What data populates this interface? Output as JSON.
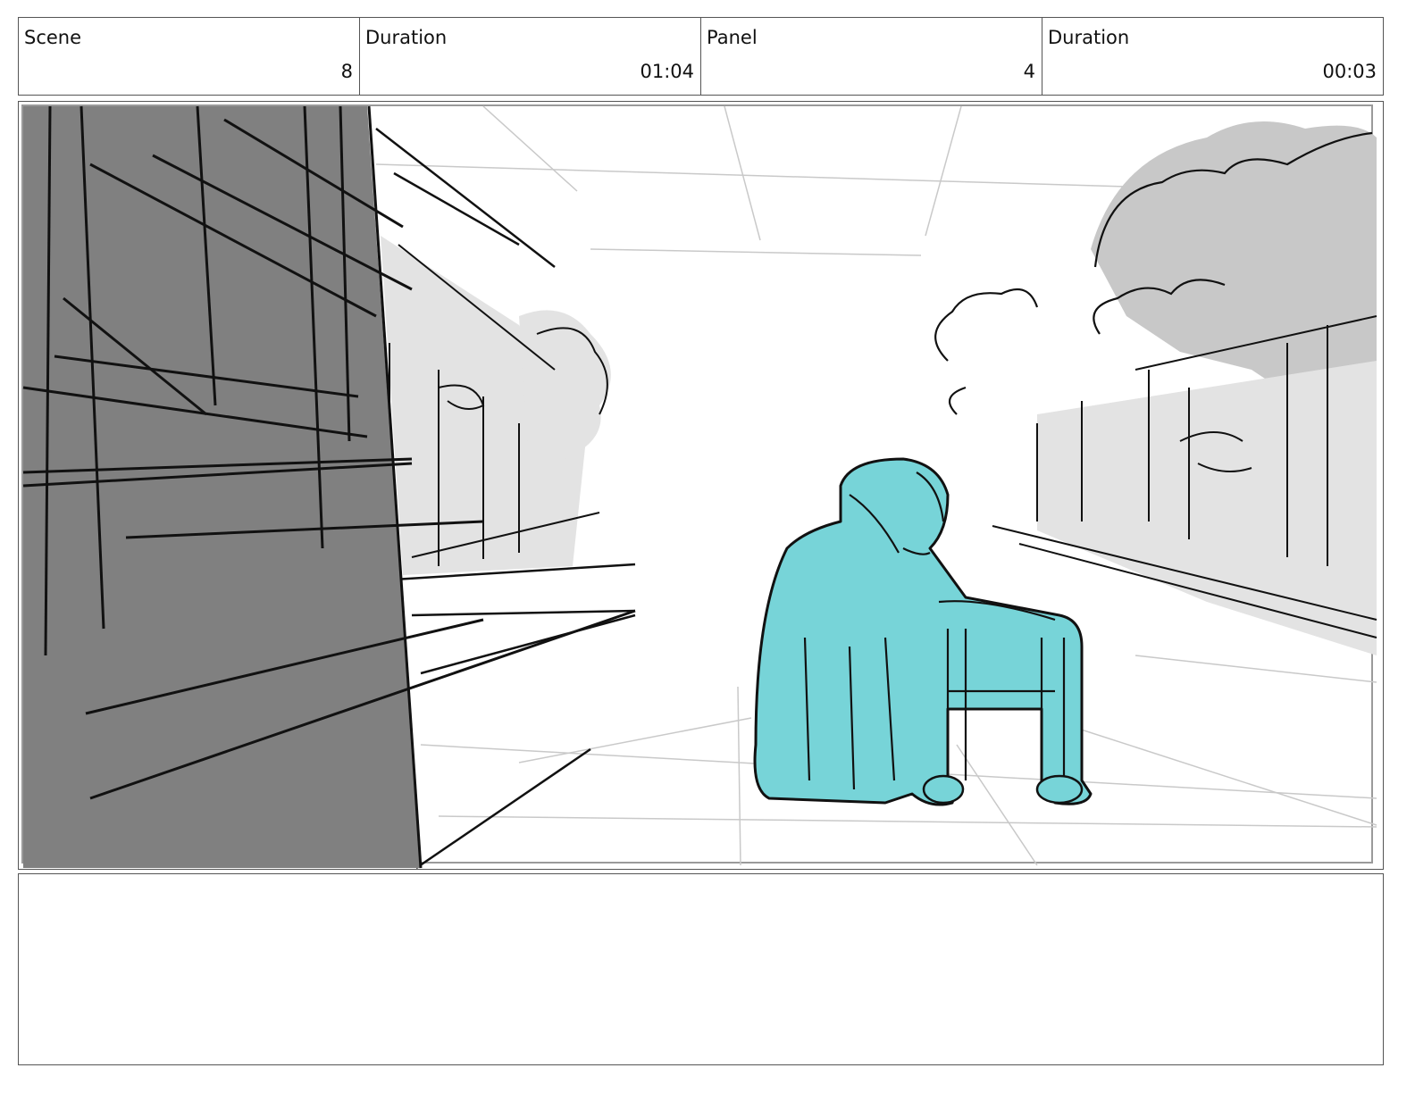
{
  "header": {
    "scene": {
      "label": "Scene",
      "value": "8"
    },
    "scene_duration": {
      "label": "Duration",
      "value": "01:04"
    },
    "panel": {
      "label": "Panel",
      "value": "4"
    },
    "panel_duration": {
      "label": "Duration",
      "value": "00:03"
    }
  },
  "sketch": {
    "subject_icon": "elderly-woman-with-walker",
    "colors": {
      "foreground_block": "#808080",
      "background_shade": "#e3e3e3",
      "tree_shade": "#c8c8c8",
      "figure": "#77d4d8",
      "ink": "#111111"
    }
  },
  "notes": {
    "text": ""
  }
}
